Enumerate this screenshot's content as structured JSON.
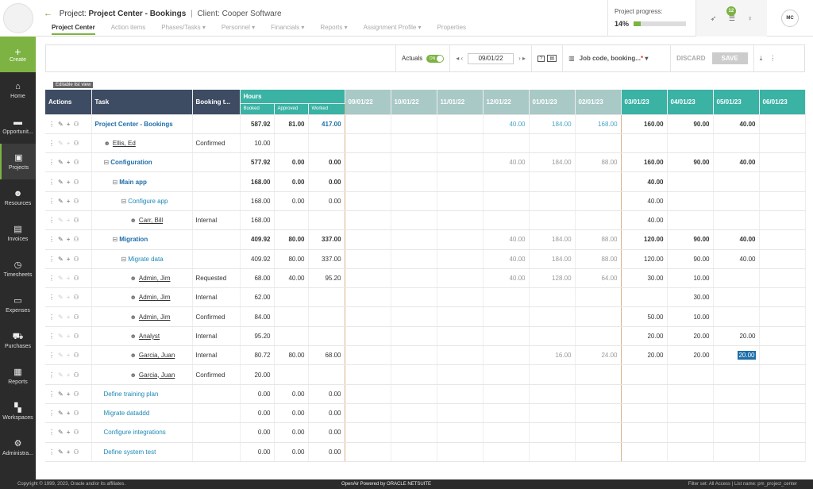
{
  "sidebar": {
    "create": "Create",
    "items": [
      {
        "label": "Home",
        "icon": "home-icon"
      },
      {
        "label": "Opportunit...",
        "icon": "chat-icon"
      },
      {
        "label": "Projects",
        "icon": "projects-icon",
        "active": true
      },
      {
        "label": "Resources",
        "icon": "people-icon"
      },
      {
        "label": "Invoices",
        "icon": "invoice-icon"
      },
      {
        "label": "Timesheets",
        "icon": "clock-icon"
      },
      {
        "label": "Expenses",
        "icon": "card-icon"
      },
      {
        "label": "Purchases",
        "icon": "cart-icon"
      },
      {
        "label": "Reports",
        "icon": "report-icon"
      },
      {
        "label": "Workspaces",
        "icon": "grid-icon"
      },
      {
        "label": "Administra...",
        "icon": "gear-icon"
      }
    ]
  },
  "header": {
    "project_prefix": "Project:",
    "project_name": "Project Center - Bookings",
    "separator": "|",
    "client": "Client: Cooper Software",
    "tabs": [
      "Project Center",
      "Action items",
      "Phases/Tasks ▾",
      "Personnel ▾",
      "Financials ▾",
      "Reports ▾",
      "Assignment Profile ▾",
      "Properties"
    ],
    "progress_label": "Project progress:",
    "progress_value": "14%",
    "progress_fraction": 0.14,
    "notif_count": "12",
    "user_initials": "MC"
  },
  "toolbar": {
    "actuals_label": "Actuals",
    "toggle_label": "ON",
    "date": "09/01/22",
    "job_field": "Job code, booking...",
    "discard": "DISCARD",
    "save": "SAVE"
  },
  "editable_tag": "Editable list view",
  "grid": {
    "headers": {
      "actions": "Actions",
      "task": "Task",
      "booking": "Booking t...",
      "hours": "Hours",
      "booked": "Booked",
      "approved": "Approved",
      "worked": "Worked"
    },
    "periods": [
      "09/01/22",
      "10/01/22",
      "11/01/22",
      "12/01/22",
      "01/01/23",
      "02/01/23",
      "03/01/23",
      "04/01/23",
      "05/01/23",
      "06/01/23"
    ],
    "rows": [
      {
        "task": "Project Center - Bookings",
        "level": 0,
        "type": "project",
        "booking": "",
        "booked": "587.92",
        "approved": "81.00",
        "worked": "417.00",
        "p": [
          "",
          "",
          "",
          "40.00",
          "184.00",
          "168.00",
          "160.00",
          "90.00",
          "40.00",
          ""
        ]
      },
      {
        "task": "Ellis, Ed",
        "level": 1,
        "type": "user",
        "booking": "Confirmed",
        "booked": "10.00",
        "approved": "",
        "worked": "",
        "p": [
          "",
          "",
          "",
          "",
          "",
          "",
          "",
          "",
          "",
          ""
        ]
      },
      {
        "task": "Configuration",
        "level": 1,
        "type": "phase",
        "booking": "",
        "booked": "577.92",
        "approved": "0.00",
        "worked": "0.00",
        "p": [
          "",
          "",
          "",
          "40.00",
          "184.00",
          "88.00",
          "160.00",
          "90.00",
          "40.00",
          ""
        ]
      },
      {
        "task": "Main app",
        "level": 2,
        "type": "phase",
        "booking": "",
        "booked": "168.00",
        "approved": "0.00",
        "worked": "0.00",
        "p": [
          "",
          "",
          "",
          "",
          "",
          "",
          "40.00",
          "",
          "",
          ""
        ]
      },
      {
        "task": "Configure app",
        "level": 3,
        "type": "task",
        "booking": "",
        "booked": "168.00",
        "approved": "0.00",
        "worked": "0.00",
        "p": [
          "",
          "",
          "",
          "",
          "",
          "",
          "40.00",
          "",
          "",
          ""
        ]
      },
      {
        "task": "Carr, Bill",
        "level": 4,
        "type": "user",
        "booking": "Internal",
        "booked": "168.00",
        "approved": "",
        "worked": "",
        "p": [
          "",
          "",
          "",
          "",
          "",
          "",
          "40.00",
          "",
          "",
          ""
        ]
      },
      {
        "task": "Migration",
        "level": 2,
        "type": "phase",
        "booking": "",
        "booked": "409.92",
        "approved": "80.00",
        "worked": "337.00",
        "p": [
          "",
          "",
          "",
          "40.00",
          "184.00",
          "88.00",
          "120.00",
          "90.00",
          "40.00",
          ""
        ]
      },
      {
        "task": "Migrate data",
        "level": 3,
        "type": "task",
        "booking": "",
        "booked": "409.92",
        "approved": "80.00",
        "worked": "337.00",
        "p": [
          "",
          "",
          "",
          "40.00",
          "184.00",
          "88.00",
          "120.00",
          "90.00",
          "40.00",
          ""
        ]
      },
      {
        "task": "Admin, Jim",
        "level": 4,
        "type": "user",
        "booking": "Requested",
        "booked": "68.00",
        "approved": "40.00",
        "worked": "95.20",
        "p": [
          "",
          "",
          "",
          "40.00",
          "128.00",
          "64.00",
          "30.00",
          "10.00",
          "",
          ""
        ]
      },
      {
        "task": "Admin, Jim",
        "level": 4,
        "type": "user",
        "booking": "Internal",
        "booked": "62.00",
        "approved": "",
        "worked": "",
        "p": [
          "",
          "",
          "",
          "",
          "",
          "",
          "",
          "30.00",
          "",
          ""
        ]
      },
      {
        "task": "Admin, Jim",
        "level": 4,
        "type": "user",
        "booking": "Confirmed",
        "booked": "84.00",
        "approved": "",
        "worked": "",
        "p": [
          "",
          "",
          "",
          "",
          "",
          "",
          "50.00",
          "10.00",
          "",
          ""
        ]
      },
      {
        "task": "Analyst",
        "level": 4,
        "type": "user",
        "booking": "Internal",
        "booked": "95.20",
        "approved": "",
        "worked": "",
        "p": [
          "",
          "",
          "",
          "",
          "",
          "",
          "20.00",
          "20.00",
          "20.00",
          ""
        ]
      },
      {
        "task": "Garcia, Juan",
        "level": 4,
        "type": "user",
        "booking": "Internal",
        "booked": "80.72",
        "approved": "80.00",
        "worked": "68.00",
        "p": [
          "",
          "",
          "",
          "",
          "16.00",
          "24.00",
          "20.00",
          "20.00",
          "20.00",
          ""
        ]
      },
      {
        "task": "Garcia, Juan",
        "level": 4,
        "type": "user",
        "booking": "Confirmed",
        "booked": "20.00",
        "approved": "",
        "worked": "",
        "p": [
          "",
          "",
          "",
          "",
          "",
          "",
          "",
          "",
          "",
          ""
        ]
      },
      {
        "task": "Define training plan",
        "level": 1,
        "type": "task",
        "booking": "",
        "booked": "0.00",
        "approved": "0.00",
        "worked": "0.00",
        "p": [
          "",
          "",
          "",
          "",
          "",
          "",
          "",
          "",
          "",
          ""
        ]
      },
      {
        "task": "Migrate dataddd",
        "level": 1,
        "type": "task",
        "booking": "",
        "booked": "0.00",
        "approved": "0.00",
        "worked": "0.00",
        "p": [
          "",
          "",
          "",
          "",
          "",
          "",
          "",
          "",
          "",
          ""
        ]
      },
      {
        "task": "Configure integrations",
        "level": 1,
        "type": "task",
        "booking": "",
        "booked": "0.00",
        "approved": "0.00",
        "worked": "0.00",
        "p": [
          "",
          "",
          "",
          "",
          "",
          "",
          "",
          "",
          "",
          ""
        ]
      },
      {
        "task": "Define system test",
        "level": 1,
        "type": "task",
        "booking": "",
        "booked": "0.00",
        "approved": "0.00",
        "worked": "0.00",
        "p": [
          "",
          "",
          "",
          "",
          "",
          "",
          "",
          "",
          "",
          ""
        ]
      }
    ]
  },
  "footer": {
    "copyright": "Copyright © 1999, 2023, Oracle and/or its affiliates.",
    "brand": "OpenAir   Powered by  ORACLE NETSUITE",
    "right": "Filter set: All Access  |  List name: pm_project_center"
  }
}
